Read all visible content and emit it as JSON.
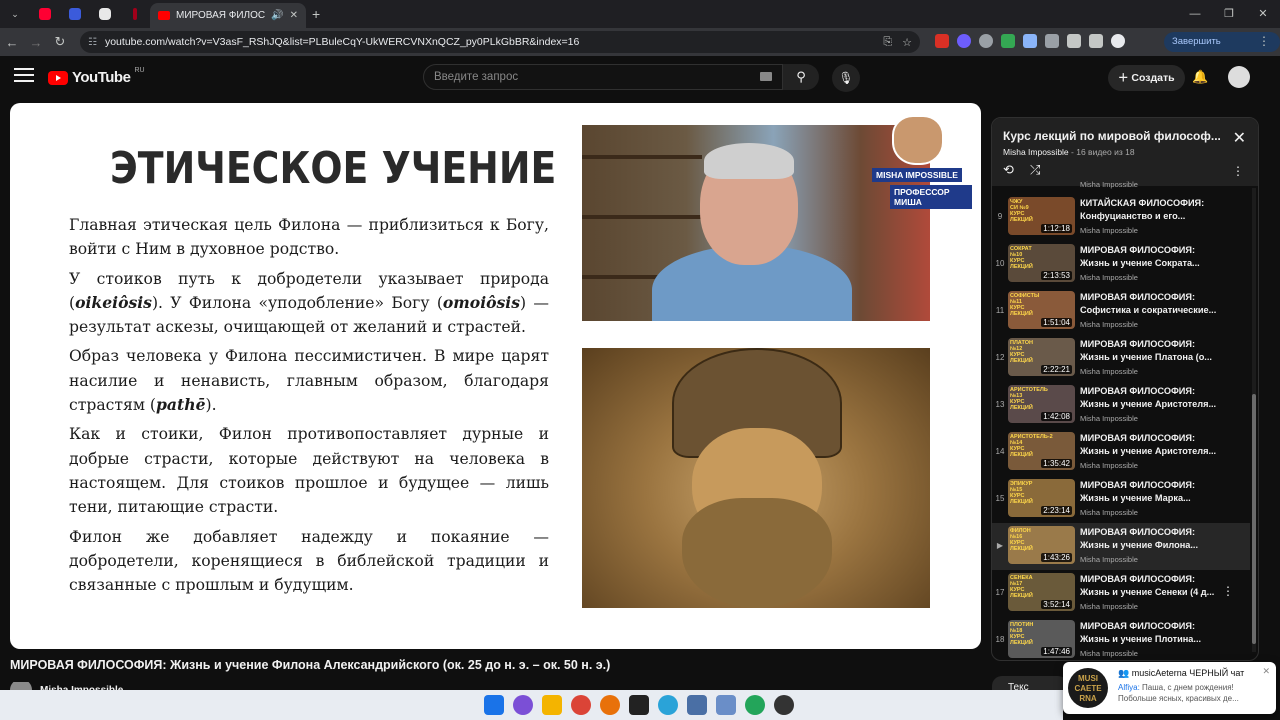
{
  "browser": {
    "active_tab_title": "МИРОВАЯ ФИЛОСОФИЯ:",
    "url": "youtube.com/watch?v=V3asF_RShJQ&list=PLBuleCqY-UkWERCVNXnQCZ_py0PLkGbBR&index=16",
    "update_label": "Завершить обновление"
  },
  "youtube": {
    "logo": "YouTube",
    "region": "RU",
    "search_placeholder": "Введите запрос",
    "create_label": "Создать"
  },
  "slide": {
    "title": "ЭТИЧЕСКОЕ УЧЕНИЕ",
    "p1": "Главная этическая цель Филона — приблизиться к Богу, войти с Ним в духовное родство.",
    "p2a": "У стоиков путь к добродетели указывает природа (",
    "p2_term1": "oikeiôsis",
    "p2b": "). У Филона «уподобление» Богу (",
    "p2_term2": "omoiôsis",
    "p2c": ") — результат аскезы, очищающей от желаний и страстей.",
    "p3a": "Образ человека у Филона пессимистичен. В мире царят насилие и ненависть, главным образом, благодаря страстям (",
    "p3_term": "pathē",
    "p3b": ").",
    "p4": "Как и стоики, Филон противопоставляет дурные и добрые страсти, которые действуют на человека в настоящем. Для стоиков прошлое и будущее — лишь тени, питающие страсти.",
    "p5": "Филон же добавляет надежду и покаяние — добродетели, коренящиеся в библейской традиции и связанные с прошлым и будущим.",
    "badge_line1": "MISHA IMPOSSIBLE",
    "badge_line2": "ПРОФЕССОР МИША"
  },
  "video": {
    "title": "МИРОВАЯ ФИЛОСОФИЯ: Жизнь и учение Филона Александрийского (ок. 25 до н. э. – ок. 50 н. э.)",
    "channel": "Misha Impossible"
  },
  "playlist": {
    "title": "Курс лекций по мировой философ...",
    "channel": "Misha Impossible",
    "position": "- 16 видео из 18",
    "top_channel": "Misha Impossible",
    "items": [
      {
        "idx": "9",
        "title": "КИТАЙСКАЯ ФИЛОСОФИЯ: Конфуцианство и его...",
        "channel": "Misha Impossible",
        "duration": "1:12:18",
        "thumb_label": "ЧЖУ СИ №9 КУРС ЛЕКЦИЙ",
        "color": "#7a4a2a"
      },
      {
        "idx": "10",
        "title": "МИРОВАЯ ФИЛОСОФИЯ: Жизнь и учение Сократа...",
        "channel": "Misha Impossible",
        "duration": "2:13:53",
        "thumb_label": "СОКРАТ №10 КУРС ЛЕКЦИЙ",
        "color": "#5a4a3a"
      },
      {
        "idx": "11",
        "title": "МИРОВАЯ ФИЛОСОФИЯ: Софистика и сократические...",
        "channel": "Misha Impossible",
        "duration": "1:51:04",
        "thumb_label": "СОФИСТЫ №11 КУРС ЛЕКЦИЙ",
        "color": "#8a5a3a"
      },
      {
        "idx": "12",
        "title": "МИРОВАЯ ФИЛОСОФИЯ: Жизнь и учение Платона (о...",
        "channel": "Misha Impossible",
        "duration": "2:22:21",
        "thumb_label": "ПЛАТОН №12 КУРС ЛЕКЦИЙ",
        "color": "#6a5a4a"
      },
      {
        "idx": "13",
        "title": "МИРОВАЯ ФИЛОСОФИЯ: Жизнь и учение Аристотеля...",
        "channel": "Misha Impossible",
        "duration": "1:42:08",
        "thumb_label": "АРИСТОТЕЛЬ №13 КУРС ЛЕКЦИЙ",
        "color": "#5a4a4a"
      },
      {
        "idx": "14",
        "title": "МИРОВАЯ ФИЛОСОФИЯ: Жизнь и учение Аристотеля...",
        "channel": "Misha Impossible",
        "duration": "1:35:42",
        "thumb_label": "АРИСТОТЕЛЬ-2 №14 КУРС ЛЕКЦИЙ",
        "color": "#7a5a3a"
      },
      {
        "idx": "15",
        "title": "МИРОВАЯ ФИЛОСОФИЯ: Жизнь и учение Марка...",
        "channel": "Misha Impossible",
        "duration": "2:23:14",
        "thumb_label": "ЭПИКУР №15 КУРС ЛЕКЦИЙ",
        "color": "#8a6a3a"
      },
      {
        "idx": "▶",
        "title": "МИРОВАЯ ФИЛОСОФИЯ: Жизнь и учение Филона...",
        "channel": "Misha Impossible",
        "duration": "1:43:26",
        "thumb_label": "ФИЛОН №16 КУРС ЛЕКЦИЙ",
        "color": "#9a7a4a"
      },
      {
        "idx": "17",
        "title": "МИРОВАЯ ФИЛОСОФИЯ: Жизнь и учение Сенеки (4 д...",
        "channel": "Misha Impossible",
        "duration": "3:52:14",
        "thumb_label": "СЕНЕКА №17 КУРС ЛЕКЦИЙ",
        "color": "#6a5a3a"
      },
      {
        "idx": "18",
        "title": "МИРОВАЯ ФИЛОСОФИЯ: Жизнь и учение Плотина...",
        "channel": "Misha Impossible",
        "duration": "1:47:46",
        "thumb_label": "ПЛОТИН №18 КУРС ЛЕКЦИЙ",
        "color": "#5a5a5a"
      }
    ]
  },
  "chat_tab": "Текс",
  "toast": {
    "avatar_text": "MUSI CAETE RNA",
    "title": "musicAeterna ЧЕРНЫЙ чат",
    "author": "Alfiya:",
    "message": "Паша, с днем рождения! Побольше ясных, красивых де..."
  },
  "colors": {
    "brand_red": "#ff0000",
    "background": "#0f0f0f",
    "badge_blue": "#1f3a8a"
  }
}
